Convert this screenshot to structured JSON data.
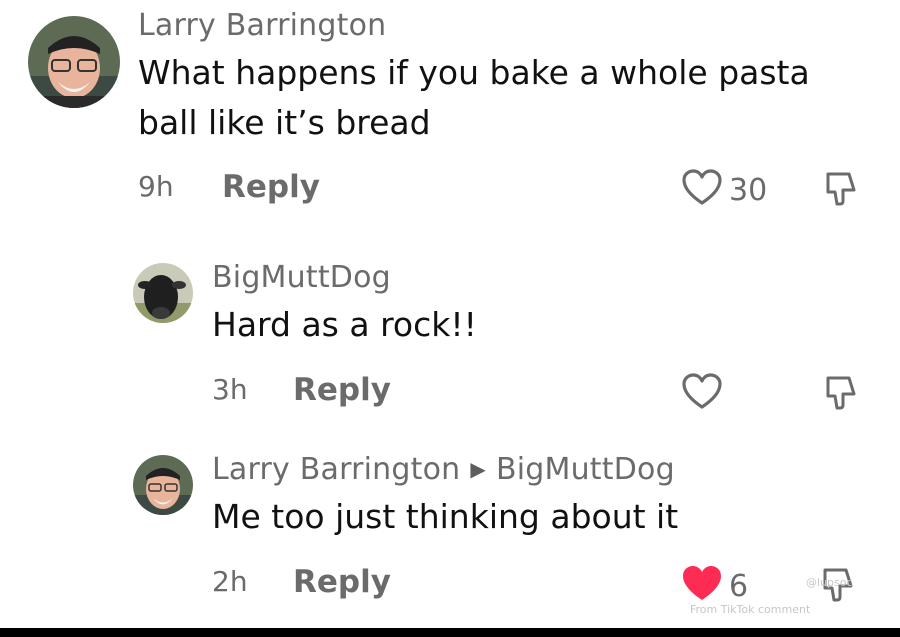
{
  "comments": [
    {
      "author": "Larry Barrington",
      "text_lines": [
        "What happens if you bake a whole pasta",
        "ball like it’s bread"
      ],
      "time": "9h",
      "reply_label": "Reply",
      "like_count": "30",
      "liked": false,
      "avatar": "larry-avatar"
    },
    {
      "author": "BigMuttDog",
      "text_lines": [
        "Hard as a rock!!"
      ],
      "time": "3h",
      "reply_label": "Reply",
      "like_count": "",
      "liked": false,
      "avatar": "cow-avatar"
    },
    {
      "author": "Larry Barrington",
      "reply_to": "BigMuttDog",
      "text_lines": [
        "Me too just thinking about it"
      ],
      "time": "2h",
      "reply_label": "Reply",
      "like_count": "6",
      "liked": true,
      "avatar": "larry-avatar"
    }
  ],
  "colors": {
    "muted": "#6b6b6b",
    "text": "#111111",
    "liked_heart": "#fe2c55"
  },
  "watermark": {
    "handle": "@lupsoc",
    "source": "From TikTok comment"
  }
}
